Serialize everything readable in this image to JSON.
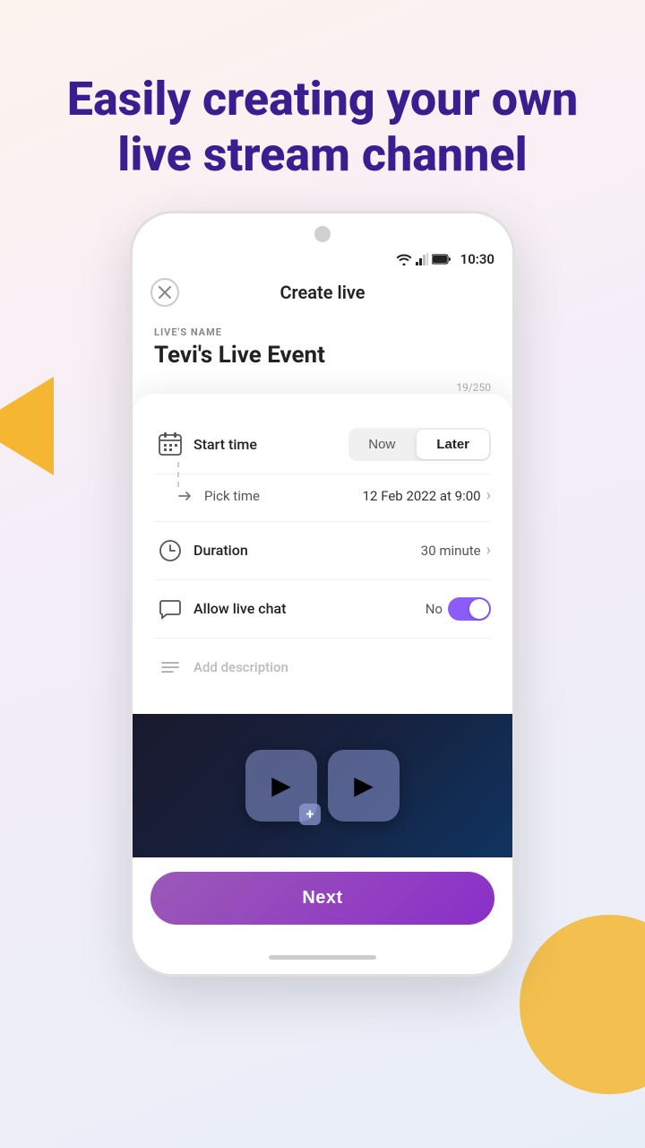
{
  "headline": {
    "line1": "Easily creating your own",
    "line2": "live stream channel"
  },
  "status_bar": {
    "time": "10:30"
  },
  "app_header": {
    "title": "Create live",
    "close_label": "×"
  },
  "live_name": {
    "label": "LIVE'S NAME",
    "value": "Tevi's Live Event",
    "char_count": "19/250"
  },
  "start_time": {
    "label": "Start time",
    "btn_now": "Now",
    "btn_later": "Later",
    "active": "Later"
  },
  "pick_time": {
    "label": "Pick time",
    "value": "12 Feb 2022 at 9:00"
  },
  "duration": {
    "label": "Duration",
    "value": "30 minute"
  },
  "allow_chat": {
    "label": "Allow live chat",
    "value": "No",
    "enabled": true
  },
  "description": {
    "placeholder": "Add description"
  },
  "next_button": {
    "label": "Next"
  }
}
